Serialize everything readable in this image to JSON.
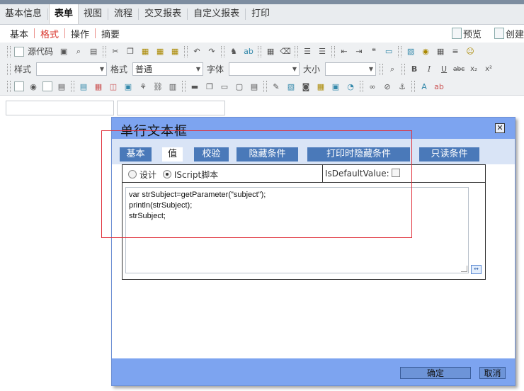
{
  "tabs": [
    "基本信息",
    "表单",
    "视图",
    "流程",
    "交叉报表",
    "自定义报表",
    "打印"
  ],
  "active_tab_index": 1,
  "subtabs": [
    "基本",
    "格式",
    "操作",
    "摘要"
  ],
  "active_subtab_index": 1,
  "subtab_right": {
    "preview": "预览",
    "create": "创建"
  },
  "toolbar": {
    "source_code": "源代码",
    "style_label": "样式",
    "format_label": "格式",
    "format_value": "普通",
    "font_label": "字体",
    "size_label": "大小"
  },
  "dialog": {
    "title": "单行文本框",
    "close_icon": "close-icon",
    "tabs": [
      "基本",
      "值",
      "校验",
      "隐藏条件",
      "打印时隐藏条件",
      "只读条件"
    ],
    "active_tab_index": 1,
    "mode_design": "设计",
    "mode_script": "IScript脚本",
    "is_default_label": "IsDefaultValue:",
    "code_lines": [
      "var strSubject=getParameter(\"subject\");",
      "println(strSubject);",
      "strSubject;"
    ],
    "ok_label": "确定",
    "cancel_label": "取消"
  },
  "colors": {
    "dialog_header": "#7da4f0",
    "dialog_tab": "#4a79b9",
    "highlight_border": "#e0303a",
    "active_subtab": "#d9342b"
  }
}
